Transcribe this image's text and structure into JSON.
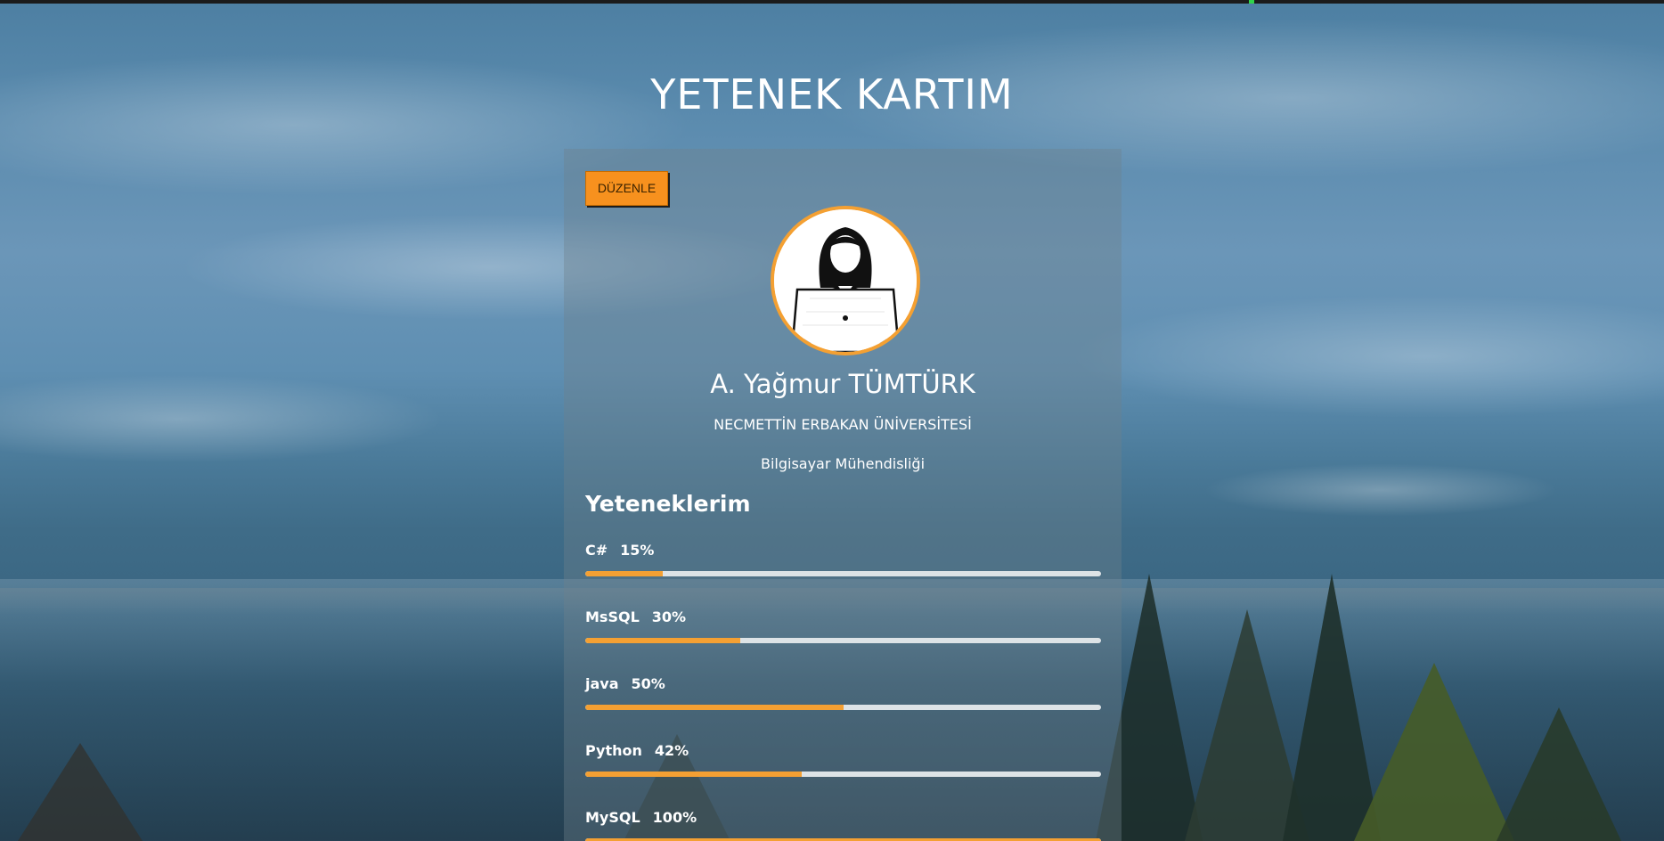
{
  "page": {
    "title": "YETENEK KARTIM"
  },
  "card": {
    "edit_label": "DÜZENLE",
    "avatar_icon": "woman-at-laptop-avatar-icon",
    "name": "A. Yağmur TÜMTÜRK",
    "school": "NECMETTİN ERBAKAN ÜNİVERSİTESİ",
    "department": "Bilgisayar Mühendisliği",
    "skills_heading": "Yeteneklerim",
    "skills": [
      {
        "name": "C#",
        "percent_label": "15%",
        "value": 15
      },
      {
        "name": "MsSQL",
        "percent_label": "30%",
        "value": 30
      },
      {
        "name": "java",
        "percent_label": "50%",
        "value": 50
      },
      {
        "name": "Python",
        "percent_label": "42%",
        "value": 42
      },
      {
        "name": "MySQL",
        "percent_label": "100%",
        "value": 100
      }
    ]
  },
  "colors": {
    "accent": "#f4a033",
    "button": "#f7911e",
    "track": "#dde3e6",
    "text": "#ffffff"
  }
}
